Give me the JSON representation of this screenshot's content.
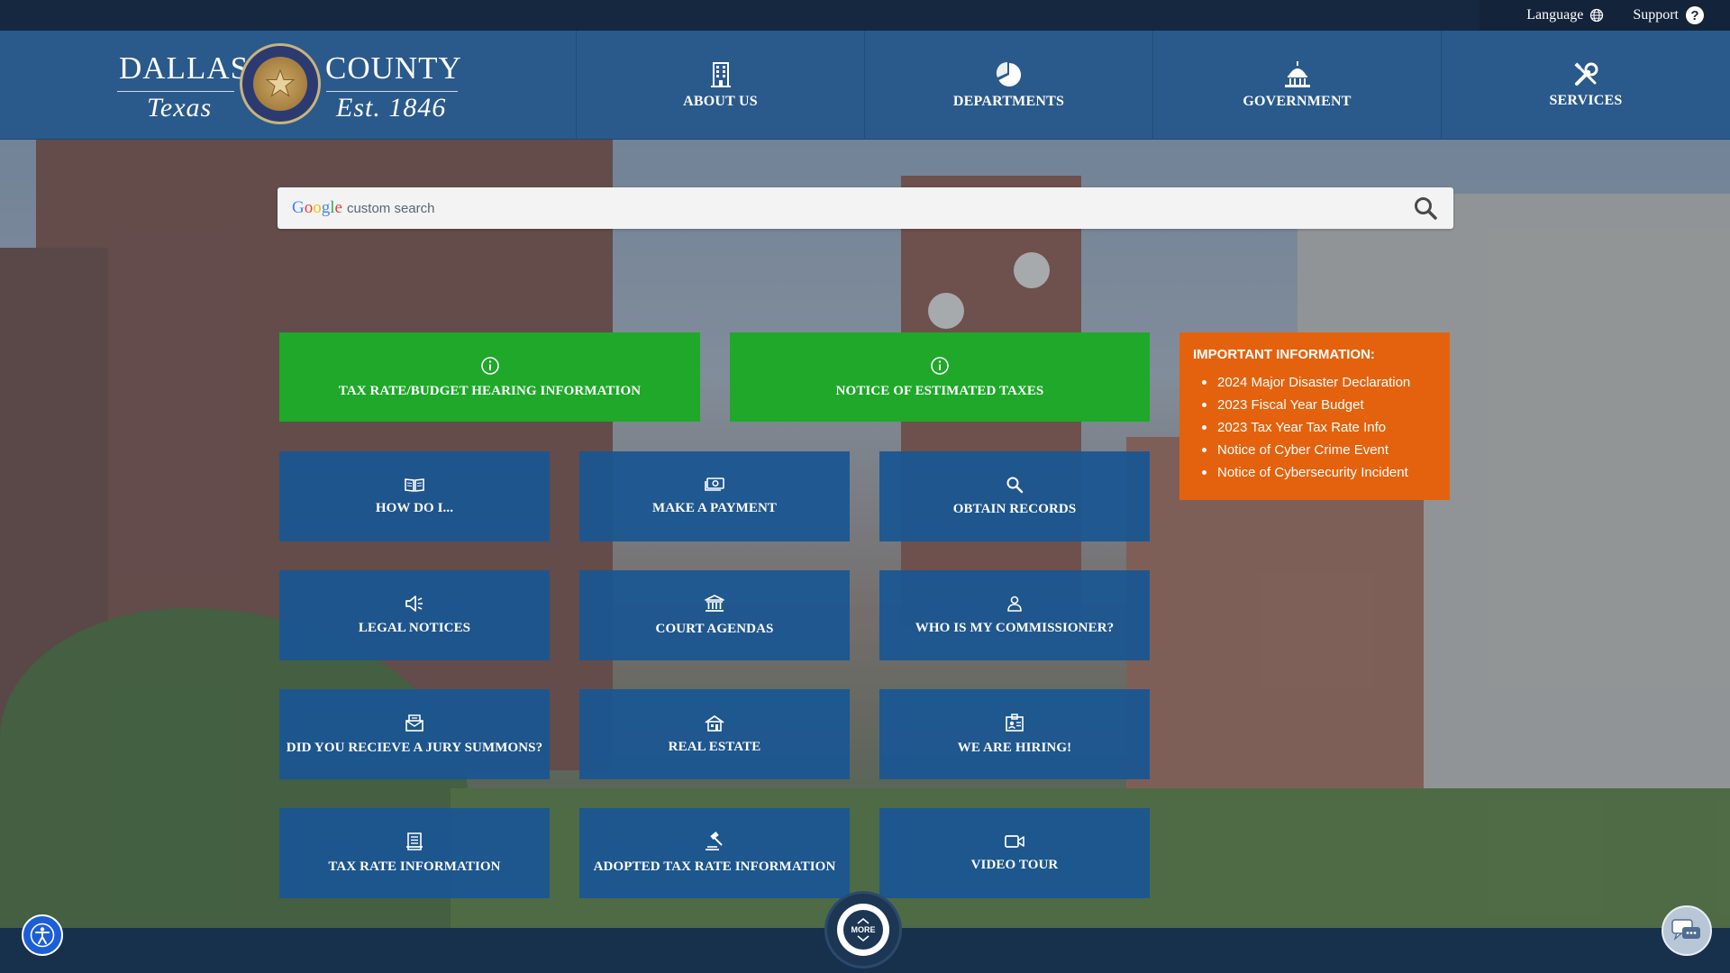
{
  "utility": {
    "language_label": "Language",
    "support_label": "Support",
    "language_icon": "globe-icon",
    "support_icon": "question-circle-icon"
  },
  "logo": {
    "line1_left": "DALLAS",
    "line1_right": "COUNTY",
    "line2_left": "Texas",
    "line2_right": "Est. 1846",
    "seal": "county-seal-image"
  },
  "nav": [
    {
      "label": "ABOUT US",
      "icon": "building-icon"
    },
    {
      "label": "DEPARTMENTS",
      "icon": "pie-chart-icon"
    },
    {
      "label": "GOVERNMENT",
      "icon": "capitol-icon"
    },
    {
      "label": "SERVICES",
      "icon": "tools-icon"
    }
  ],
  "search": {
    "brand": "Google",
    "placeholder": "custom search",
    "icon": "search-icon"
  },
  "tiles": {
    "tax_hearing": {
      "label": "TAX RATE/BUDGET HEARING INFORMATION",
      "icon": "info-circle-icon"
    },
    "estimated_taxes": {
      "label": "NOTICE OF ESTIMATED TAXES",
      "icon": "info-circle-icon"
    },
    "how_do_i": {
      "label": "HOW DO I...",
      "icon": "open-book-icon"
    },
    "make_payment": {
      "label": "MAKE A PAYMENT",
      "icon": "money-icon"
    },
    "obtain_records": {
      "label": "OBTAIN RECORDS",
      "icon": "search-icon"
    },
    "legal_notices": {
      "label": "LEGAL NOTICES",
      "icon": "megaphone-icon"
    },
    "court_agendas": {
      "label": "COURT AGENDAS",
      "icon": "courthouse-icon"
    },
    "commissioner": {
      "label": "WHO IS MY COMMISSIONER?",
      "icon": "person-icon"
    },
    "jury_summons": {
      "label": "DID YOU RECIEVE A JURY SUMMONS?",
      "icon": "mail-summons-icon"
    },
    "real_estate": {
      "label": "REAL ESTATE",
      "icon": "house-icon"
    },
    "hiring": {
      "label": "WE ARE HIRING!",
      "icon": "id-badge-icon"
    },
    "tax_rate_info": {
      "label": "TAX RATE INFORMATION",
      "icon": "receipt-icon"
    },
    "adopted_tax": {
      "label": "ADOPTED TAX RATE INFORMATION",
      "icon": "gavel-icon"
    },
    "video_tour": {
      "label": "VIDEO TOUR",
      "icon": "video-camera-icon"
    }
  },
  "important": {
    "title": "IMPORTANT INFORMATION:",
    "items": [
      "2024 Major Disaster Declaration",
      "2023 Fiscal Year Budget",
      "2023 Tax Year Tax Rate Info",
      "Notice of Cyber Crime Event",
      "Notice of Cybersecurity Incident"
    ]
  },
  "footer": {
    "more_label": "MORE",
    "accessibility_icon": "accessibility-icon",
    "chat_icon": "chat-bubbles-icon"
  },
  "colors": {
    "header_blue": "#2a5a8c",
    "tile_blue": "#1b5692",
    "tile_green": "#1fa82a",
    "info_orange": "#e4620e",
    "footer_navy": "#17304c"
  }
}
